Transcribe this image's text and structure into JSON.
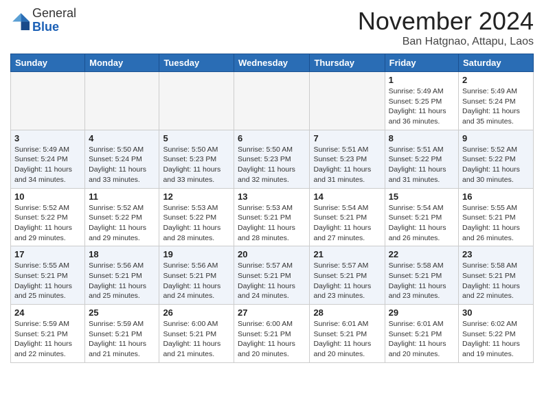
{
  "header": {
    "logo_general": "General",
    "logo_blue": "Blue",
    "month_title": "November 2024",
    "subtitle": "Ban Hatgnao, Attapu, Laos"
  },
  "weekdays": [
    "Sunday",
    "Monday",
    "Tuesday",
    "Wednesday",
    "Thursday",
    "Friday",
    "Saturday"
  ],
  "weeks": [
    [
      {
        "day": "",
        "info": ""
      },
      {
        "day": "",
        "info": ""
      },
      {
        "day": "",
        "info": ""
      },
      {
        "day": "",
        "info": ""
      },
      {
        "day": "",
        "info": ""
      },
      {
        "day": "1",
        "info": "Sunrise: 5:49 AM\nSunset: 5:25 PM\nDaylight: 11 hours and 36 minutes."
      },
      {
        "day": "2",
        "info": "Sunrise: 5:49 AM\nSunset: 5:24 PM\nDaylight: 11 hours and 35 minutes."
      }
    ],
    [
      {
        "day": "3",
        "info": "Sunrise: 5:49 AM\nSunset: 5:24 PM\nDaylight: 11 hours and 34 minutes."
      },
      {
        "day": "4",
        "info": "Sunrise: 5:50 AM\nSunset: 5:24 PM\nDaylight: 11 hours and 33 minutes."
      },
      {
        "day": "5",
        "info": "Sunrise: 5:50 AM\nSunset: 5:23 PM\nDaylight: 11 hours and 33 minutes."
      },
      {
        "day": "6",
        "info": "Sunrise: 5:50 AM\nSunset: 5:23 PM\nDaylight: 11 hours and 32 minutes."
      },
      {
        "day": "7",
        "info": "Sunrise: 5:51 AM\nSunset: 5:23 PM\nDaylight: 11 hours and 31 minutes."
      },
      {
        "day": "8",
        "info": "Sunrise: 5:51 AM\nSunset: 5:22 PM\nDaylight: 11 hours and 31 minutes."
      },
      {
        "day": "9",
        "info": "Sunrise: 5:52 AM\nSunset: 5:22 PM\nDaylight: 11 hours and 30 minutes."
      }
    ],
    [
      {
        "day": "10",
        "info": "Sunrise: 5:52 AM\nSunset: 5:22 PM\nDaylight: 11 hours and 29 minutes."
      },
      {
        "day": "11",
        "info": "Sunrise: 5:52 AM\nSunset: 5:22 PM\nDaylight: 11 hours and 29 minutes."
      },
      {
        "day": "12",
        "info": "Sunrise: 5:53 AM\nSunset: 5:22 PM\nDaylight: 11 hours and 28 minutes."
      },
      {
        "day": "13",
        "info": "Sunrise: 5:53 AM\nSunset: 5:21 PM\nDaylight: 11 hours and 28 minutes."
      },
      {
        "day": "14",
        "info": "Sunrise: 5:54 AM\nSunset: 5:21 PM\nDaylight: 11 hours and 27 minutes."
      },
      {
        "day": "15",
        "info": "Sunrise: 5:54 AM\nSunset: 5:21 PM\nDaylight: 11 hours and 26 minutes."
      },
      {
        "day": "16",
        "info": "Sunrise: 5:55 AM\nSunset: 5:21 PM\nDaylight: 11 hours and 26 minutes."
      }
    ],
    [
      {
        "day": "17",
        "info": "Sunrise: 5:55 AM\nSunset: 5:21 PM\nDaylight: 11 hours and 25 minutes."
      },
      {
        "day": "18",
        "info": "Sunrise: 5:56 AM\nSunset: 5:21 PM\nDaylight: 11 hours and 25 minutes."
      },
      {
        "day": "19",
        "info": "Sunrise: 5:56 AM\nSunset: 5:21 PM\nDaylight: 11 hours and 24 minutes."
      },
      {
        "day": "20",
        "info": "Sunrise: 5:57 AM\nSunset: 5:21 PM\nDaylight: 11 hours and 24 minutes."
      },
      {
        "day": "21",
        "info": "Sunrise: 5:57 AM\nSunset: 5:21 PM\nDaylight: 11 hours and 23 minutes."
      },
      {
        "day": "22",
        "info": "Sunrise: 5:58 AM\nSunset: 5:21 PM\nDaylight: 11 hours and 23 minutes."
      },
      {
        "day": "23",
        "info": "Sunrise: 5:58 AM\nSunset: 5:21 PM\nDaylight: 11 hours and 22 minutes."
      }
    ],
    [
      {
        "day": "24",
        "info": "Sunrise: 5:59 AM\nSunset: 5:21 PM\nDaylight: 11 hours and 22 minutes."
      },
      {
        "day": "25",
        "info": "Sunrise: 5:59 AM\nSunset: 5:21 PM\nDaylight: 11 hours and 21 minutes."
      },
      {
        "day": "26",
        "info": "Sunrise: 6:00 AM\nSunset: 5:21 PM\nDaylight: 11 hours and 21 minutes."
      },
      {
        "day": "27",
        "info": "Sunrise: 6:00 AM\nSunset: 5:21 PM\nDaylight: 11 hours and 20 minutes."
      },
      {
        "day": "28",
        "info": "Sunrise: 6:01 AM\nSunset: 5:21 PM\nDaylight: 11 hours and 20 minutes."
      },
      {
        "day": "29",
        "info": "Sunrise: 6:01 AM\nSunset: 5:21 PM\nDaylight: 11 hours and 20 minutes."
      },
      {
        "day": "30",
        "info": "Sunrise: 6:02 AM\nSunset: 5:22 PM\nDaylight: 11 hours and 19 minutes."
      }
    ]
  ]
}
